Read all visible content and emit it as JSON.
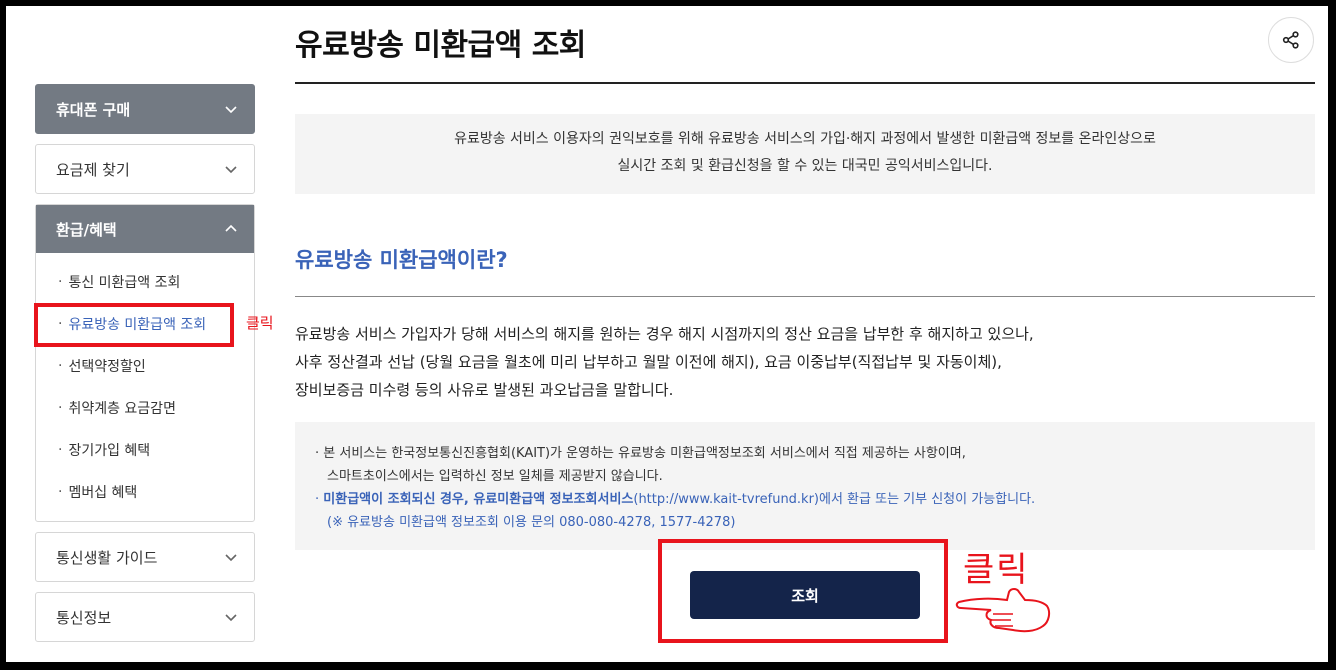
{
  "page": {
    "title": "유료방송 미환급액 조회"
  },
  "sidebar": {
    "menus": [
      {
        "label": "휴대폰 구매"
      },
      {
        "label": "요금제 찾기"
      },
      {
        "label": "환급/혜택"
      },
      {
        "label": "통신생활 가이드"
      },
      {
        "label": "통신정보"
      }
    ],
    "sub_items": [
      {
        "label": "통신 미환급액 조회"
      },
      {
        "label": "유료방송 미환급액 조회"
      },
      {
        "label": "선택약정할인"
      },
      {
        "label": "취약계층 요금감면"
      },
      {
        "label": "장기가입 혜택"
      },
      {
        "label": "멤버십 혜택"
      }
    ],
    "bullet": "·",
    "click_annotation": "클릭"
  },
  "intro": {
    "line1": "유료방송 서비스 이용자의 권익보호를 위해 유료방송 서비스의 가입·해지 과정에서 발생한 미환급액 정보를 온라인상으로",
    "line2": "실시간 조회 및 환급신청을 할 수 있는 대국민 공익서비스입니다."
  },
  "section": {
    "title": "유료방송 미환급액이란?",
    "desc": [
      "유료방송 서비스 가입자가 당해 서비스의 해지를 원하는 경우 해지 시점까지의 정산 요금을 납부한 후 해지하고 있으나,",
      "사후 정산결과 선납 (당월 요금을 월초에 미리 납부하고 월말 이전에 해지), 요금 이중납부(직접납부 및 자동이체),",
      "장비보증금 미수령 등의 사유로 발생된 과오납금을 말합니다."
    ]
  },
  "notice": {
    "bullet": "·",
    "line1": "본 서비스는 한국정보통신진흥협회(KAIT)가 운영하는 유료방송 미환급액정보조회 서비스에서 직접 제공하는 사항이며,",
    "line2": "스마트초이스에서는 입력하신 정보 일체를 제공받지 않습니다.",
    "line3_bold": "미환급액이 조회되신 경우, 유료미환급액 정보조회서비스",
    "line3_rest": "(http://www.kait-tvrefund.kr)에서 환급 또는 기부 신청이 가능합니다.",
    "line4": "(※ 유료방송 미환급액 정보조회 이용 문의 080-080-4278, 1577-4278)"
  },
  "action": {
    "query_label": "조회",
    "click_annotation": "클릭"
  },
  "colors": {
    "accent_blue": "#3a63b8",
    "button_navy": "#14244a",
    "annotation_red": "#e8141c",
    "menu_gray": "#737a83"
  },
  "icons": [
    "share-icon",
    "chevron-down-icon",
    "chevron-up-icon",
    "pointing-hand-icon"
  ]
}
